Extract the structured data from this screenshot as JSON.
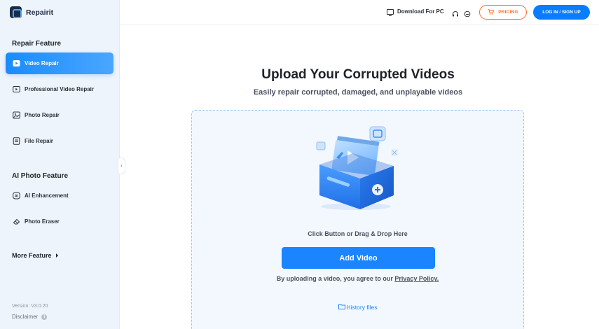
{
  "app": {
    "name": "Repairit"
  },
  "sidebar": {
    "section1_title": "Repair Feature",
    "repair_items": [
      {
        "label": "Video Repair",
        "icon": "play-icon",
        "active": true
      },
      {
        "label": "Professional Video Repair",
        "icon": "video-play-icon",
        "active": false
      },
      {
        "label": "Photo Repair",
        "icon": "photo-icon",
        "active": false
      },
      {
        "label": "File Repair",
        "icon": "file-icon",
        "active": false
      }
    ],
    "section2_title": "AI Photo Feature",
    "ai_items": [
      {
        "label": "AI Enhancement",
        "icon": "ai-icon"
      },
      {
        "label": "Photo Eraser",
        "icon": "eraser-icon"
      }
    ],
    "more_feature": "More Feature",
    "version": "Version: V3.0.20",
    "disclaimer": "Disclaimer"
  },
  "header": {
    "download_pc": "Download For PC",
    "pricing": "PRICING",
    "login": "LOG IN / SIGN UP"
  },
  "main": {
    "title": "Upload Your Corrupted Videos",
    "subtitle": "Easily repair corrupted, damaged, and unplayable videos",
    "drop_text": "Click Button or Drag & Drop Here",
    "add_button": "Add Video",
    "agree_prefix": "By uploading a video, you agree to our ",
    "privacy_link": "Privacy Policy.",
    "history": "History files"
  },
  "colors": {
    "accent": "#1a85ff",
    "pricing": "#ff6a2b",
    "sidebar_bg": "#eef4fb"
  }
}
